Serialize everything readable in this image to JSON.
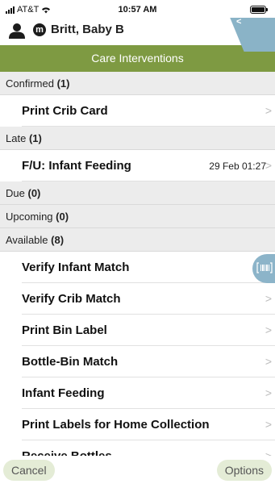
{
  "status_bar": {
    "carrier": "AT&T",
    "time": "10:57 AM"
  },
  "patient": {
    "badge": "m",
    "name": "Britt, Baby B",
    "back_glyph": "<"
  },
  "header": {
    "title": "Care Interventions"
  },
  "sections": [
    {
      "label": "Confirmed",
      "count": "(1)"
    },
    {
      "label": "Late",
      "count": "(1)"
    },
    {
      "label": "Due",
      "count": "(0)"
    },
    {
      "label": "Upcoming",
      "count": "(0)"
    },
    {
      "label": "Available",
      "count": "(8)"
    }
  ],
  "items": {
    "print_crib_card": "Print Crib Card",
    "fu_infant_feeding": "F/U: Infant Feeding",
    "fu_infant_feeding_date": "29 Feb 01:27",
    "verify_infant_match": "Verify Infant Match",
    "verify_crib_match": "Verify Crib Match",
    "print_bin_label": "Print Bin Label",
    "bottle_bin_match": "Bottle-Bin Match",
    "infant_feeding": "Infant Feeding",
    "print_labels_home": "Print Labels for Home Collection",
    "receive_bottles": "Receive Bottles"
  },
  "chevron": ">",
  "footer": {
    "cancel_label": "Cancel",
    "options_label": "Options"
  },
  "icons": {
    "signal": "signal-bars-icon",
    "wifi": "wifi-icon",
    "battery": "battery-icon",
    "person": "person-icon",
    "scan": "barcode-scan-icon"
  }
}
